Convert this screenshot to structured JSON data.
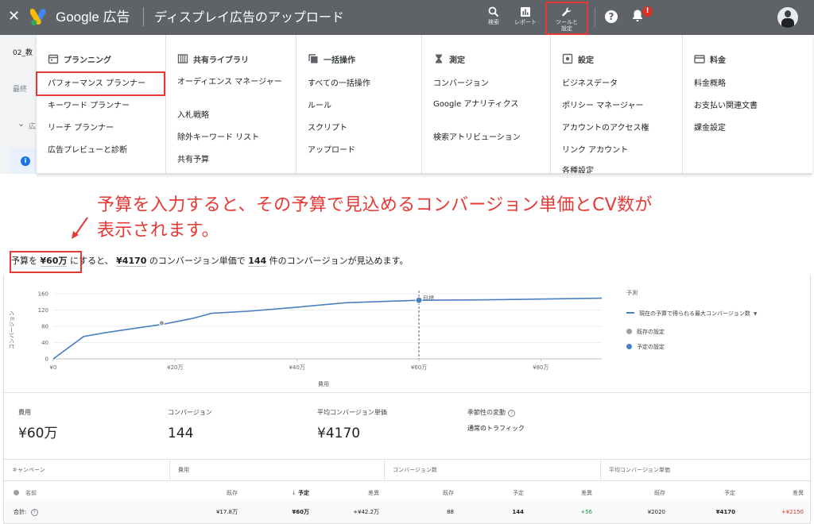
{
  "header": {
    "close_glyph": "✕",
    "brand": "Google 広告",
    "page_title": "ディスプレイ広告のアップロード",
    "search_label": "検索",
    "reports_label": "レポート",
    "tools_label_1": "ツールと",
    "tools_label_2": "設定",
    "help_glyph": "?",
    "notification_count": "!"
  },
  "background": {
    "campaign_name": "02_教",
    "last_text": "最終",
    "section_text": "広"
  },
  "tools_menu": {
    "columns": [
      {
        "title": "プランニング",
        "items": [
          "パフォーマンス プランナー",
          "キーワード プランナー",
          "リーチ プランナー",
          "広告プレビューと診断"
        ]
      },
      {
        "title": "共有ライブラリ",
        "items": [
          "オーディエンス マネージャー",
          "入札戦略",
          "除外キーワード リスト",
          "共有予算"
        ]
      },
      {
        "title": "一括操作",
        "items": [
          "すべての一括操作",
          "ルール",
          "スクリプト",
          "アップロード"
        ]
      },
      {
        "title": "測定",
        "items": [
          "コンバージョン",
          "Google アナリティクス",
          "検索アトリビューション"
        ]
      },
      {
        "title": "設定",
        "items": [
          "ビジネスデータ",
          "ポリシー マネージャー",
          "アカウントのアクセス権",
          "リンク アカウント",
          "各種設定"
        ]
      },
      {
        "title": "料金",
        "items": [
          "料金概略",
          "お支払い関連文書",
          "課金設定"
        ]
      }
    ]
  },
  "annotation": {
    "line1": "予算を入力すると、その予算で見込めるコンバージョン単価とCV数が",
    "line2": "表示されます。"
  },
  "forecast_sentence": {
    "prefix": "予算を",
    "budget": "¥60万",
    "mid1": "にすると、",
    "cpa": "¥4170",
    "mid2": "のコンバージョン単価で",
    "conversions": "144",
    "suffix": "件のコンバージョンが見込めます。"
  },
  "chart_data": {
    "type": "line",
    "title": "",
    "xlabel": "費用",
    "ylabel": "コンバージョン",
    "xlim": [
      0,
      900000
    ],
    "ylim": [
      0,
      160
    ],
    "x_ticks": [
      0,
      200000,
      400000,
      600000,
      800000
    ],
    "x_tick_labels": [
      "¥0",
      "¥20万",
      "¥40万",
      "¥60万",
      "¥80万"
    ],
    "y_ticks": [
      0,
      40,
      80,
      120,
      160
    ],
    "series": [
      {
        "name": "現在の予算で得られる最大コンバージョン数",
        "color": "#4a7fc1",
        "x": [
          0,
          50000,
          80000,
          120000,
          180000,
          230000,
          260000,
          320000,
          400000,
          480000,
          560000,
          600000,
          700000,
          800000,
          900000
        ],
        "y": [
          0,
          55,
          63,
          72,
          85,
          100,
          112,
          117,
          127,
          138,
          142,
          144,
          145,
          147,
          149
        ]
      }
    ],
    "points": [
      {
        "name": "既存の設定",
        "x": 178000,
        "y": 88,
        "color": "#9aa0a6"
      },
      {
        "name": "予定の設定",
        "x": 600000,
        "y": 144,
        "color": "#4a7fc1"
      }
    ],
    "target_marker": {
      "x": 600000,
      "label": "目標"
    },
    "legend": {
      "title": "予測",
      "position": "right"
    },
    "grid": true
  },
  "legend": {
    "title": "予測",
    "series_label": "現在の予算で得られる最大コンバージョン数",
    "existing_label": "既存の設定",
    "planned_label": "予定の設定",
    "caret": "▼"
  },
  "stats": [
    {
      "label": "費用",
      "value": "¥60万"
    },
    {
      "label": "コンバージョン",
      "value": "144"
    },
    {
      "label": "平均コンバージョン単価",
      "value": "¥4170"
    },
    {
      "label": "季節性の変動",
      "value": "通常のトラフィック",
      "help": "?"
    }
  ],
  "table": {
    "groups": [
      "キャンペーン",
      "費用",
      "コンバージョン数",
      "平均コンバージョン単価"
    ],
    "name_header": "名前",
    "sub_existing": "既存",
    "sub_planned": "予定",
    "sub_diff": "差異",
    "sort_arrow": "↓",
    "total_label": "合計:",
    "total_help": "?",
    "totals": {
      "cost_existing": "¥17.8万",
      "cost_planned": "¥60万",
      "cost_diff": "+¥42.2万",
      "conv_existing": "88",
      "conv_planned": "144",
      "conv_diff": "+56",
      "cpa_existing": "¥2020",
      "cpa_planned": "¥4170",
      "cpa_diff": "+¥2150"
    },
    "colors": {
      "positive": "#1e8e3e",
      "negative": "#d93025"
    }
  }
}
